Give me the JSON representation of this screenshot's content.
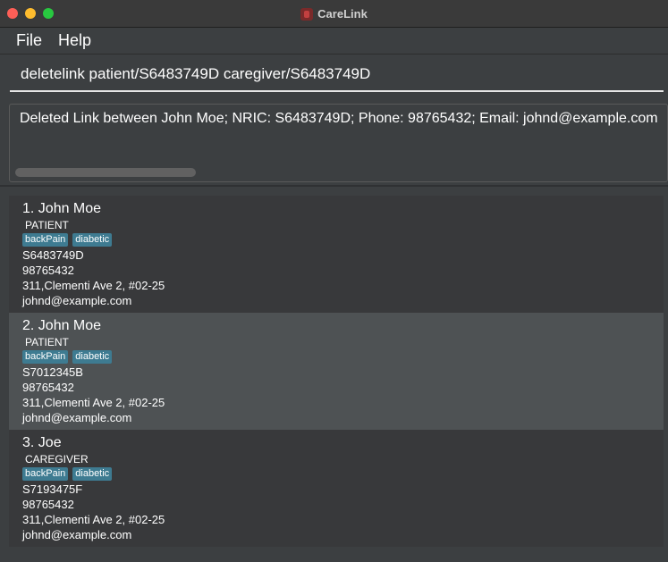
{
  "window": {
    "title": "CareLink"
  },
  "menu": {
    "items": [
      "File",
      "Help"
    ]
  },
  "command": {
    "value": "deletelink patient/S6483749D caregiver/S6483749D"
  },
  "result": {
    "text": "Deleted Link between John Moe; NRIC: S6483749D; Phone: 98765432; Email: johnd@example.com"
  },
  "persons": [
    {
      "name": "1. John Moe",
      "role": "PATIENT",
      "tags": [
        "backPain",
        "diabetic"
      ],
      "nric": "S6483749D",
      "phone": "98765432",
      "address": "311,Clementi Ave 2, #02-25",
      "email": "johnd@example.com"
    },
    {
      "name": "2. John Moe",
      "role": "PATIENT",
      "tags": [
        "backPain",
        "diabetic"
      ],
      "nric": "S7012345B",
      "phone": "98765432",
      "address": "311,Clementi Ave 2, #02-25",
      "email": "johnd@example.com"
    },
    {
      "name": "3. Joe",
      "role": "CAREGIVER",
      "tags": [
        "backPain",
        "diabetic"
      ],
      "nric": "S7193475F",
      "phone": "98765432",
      "address": "311,Clementi Ave 2, #02-25",
      "email": "johnd@example.com"
    }
  ],
  "colors": {
    "background": "#3c3f41",
    "selected_card": "#4e5254",
    "tag": "#3e7b91",
    "close_button": "#fe5f57",
    "minimize_button": "#febc2e",
    "maximize_button": "#28c840"
  }
}
